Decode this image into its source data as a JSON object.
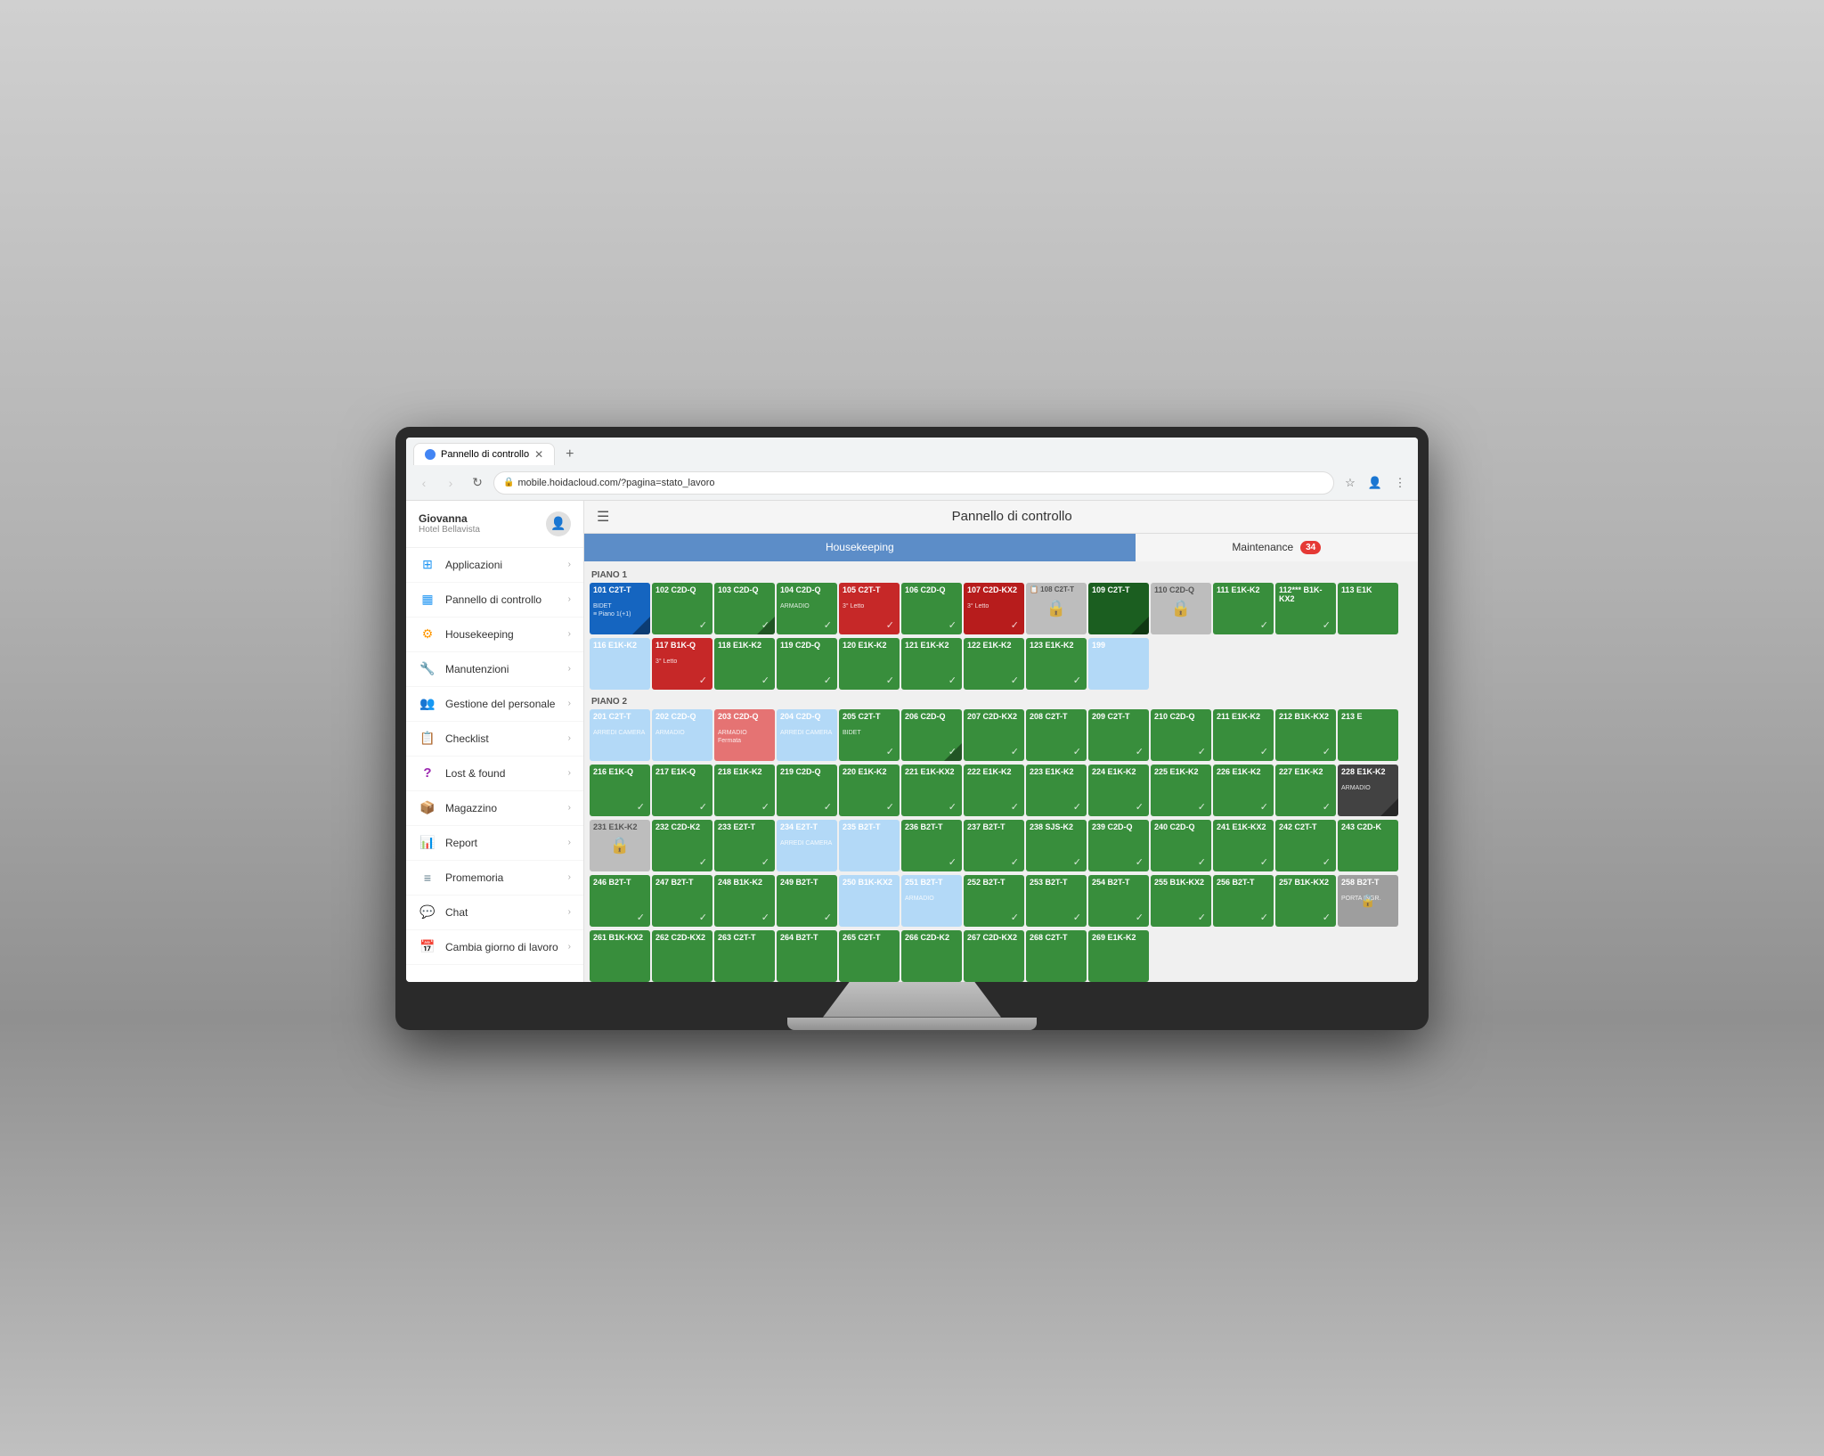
{
  "browser": {
    "tab_title": "Pannello di controllo",
    "url": "mobile.hoidacloud.com/?pagina=stato_lavoro",
    "new_tab_label": "+"
  },
  "header": {
    "menu_icon": "☰",
    "title": "Pannello di controllo"
  },
  "tabs": {
    "housekeeping": "Housekeeping",
    "maintenance": "Maintenance",
    "maintenance_badge": "34"
  },
  "sidebar": {
    "user_name": "Giovanna",
    "user_hotel": "Hotel Bellavista",
    "items": [
      {
        "id": "applicazioni",
        "label": "Applicazioni",
        "icon": "⊞",
        "icon_class": "icon-apps"
      },
      {
        "id": "pannello",
        "label": "Pannello di controllo",
        "icon": "▦",
        "icon_class": "icon-dashboard"
      },
      {
        "id": "housekeeping",
        "label": "Housekeeping",
        "icon": "⚙",
        "icon_class": "icon-housekeeping"
      },
      {
        "id": "manutenzioni",
        "label": "Manutenzioni",
        "icon": "🔧",
        "icon_class": "icon-maintenance"
      },
      {
        "id": "gestione",
        "label": "Gestione del personale",
        "icon": "👥",
        "icon_class": "icon-staff"
      },
      {
        "id": "checklist",
        "label": "Checklist",
        "icon": "📋",
        "icon_class": "icon-checklist"
      },
      {
        "id": "lost",
        "label": "Lost & found",
        "icon": "?",
        "icon_class": "icon-lost"
      },
      {
        "id": "magazzino",
        "label": "Magazzino",
        "icon": "📦",
        "icon_class": "icon-warehouse"
      },
      {
        "id": "report",
        "label": "Report",
        "icon": "📊",
        "icon_class": "icon-report"
      },
      {
        "id": "promemoria",
        "label": "Promemoria",
        "icon": "≡",
        "icon_class": "icon-promemoria"
      },
      {
        "id": "chat",
        "label": "Chat",
        "icon": "💬",
        "icon_class": "icon-chat"
      },
      {
        "id": "cambia",
        "label": "Cambia giorno di lavoro",
        "icon": "📅",
        "icon_class": "icon-calendar"
      }
    ]
  },
  "floor1": {
    "label": "PIANO 1",
    "rooms": [
      {
        "number": "101",
        "type": "C2T-T",
        "note": "BIDET\n≡ Piano 1(+1)",
        "color": "blue",
        "triangle": true
      },
      {
        "number": "102",
        "type": "C2D-Q",
        "note": "",
        "color": "mid-green",
        "check": true
      },
      {
        "number": "103",
        "type": "C2D-Q",
        "note": "",
        "color": "mid-green",
        "check": true,
        "triangle": true
      },
      {
        "number": "104",
        "type": "C2D-Q",
        "note": "ARMADIO",
        "color": "mid-green",
        "check": true
      },
      {
        "number": "105",
        "type": "C2T-T",
        "note": "3° Letto",
        "color": "red",
        "check": true
      },
      {
        "number": "106",
        "type": "C2D-Q",
        "note": "",
        "color": "mid-green",
        "check": true
      },
      {
        "number": "107",
        "type": "C2D-KX2",
        "note": "3° Letto",
        "color": "dark-red",
        "check": true
      },
      {
        "number": "108",
        "type": "C2T-T",
        "note": "",
        "color": "locked"
      },
      {
        "number": "109",
        "type": "C2T-T",
        "note": "",
        "color": "dark-green",
        "triangle": true
      },
      {
        "number": "110",
        "type": "C2D-Q",
        "note": "",
        "color": "locked"
      },
      {
        "number": "111",
        "type": "E1K-K2",
        "note": "",
        "color": "mid-green",
        "check": true
      },
      {
        "number": "112***",
        "type": "B1K-KX2",
        "note": "",
        "color": "mid-green",
        "check": true
      },
      {
        "number": "113",
        "type": "E1K",
        "note": "",
        "color": "mid-green"
      }
    ]
  },
  "floor1b": {
    "rooms": [
      {
        "number": "116",
        "type": "E1K-K2",
        "note": "",
        "color": "sky-blue"
      },
      {
        "number": "117",
        "type": "B1K-Q",
        "note": "3° Letto",
        "color": "red",
        "check": true
      },
      {
        "number": "118",
        "type": "E1K-K2",
        "note": "",
        "color": "mid-green",
        "check": true
      },
      {
        "number": "119",
        "type": "C2D-Q",
        "note": "",
        "color": "mid-green",
        "check": true
      },
      {
        "number": "120",
        "type": "E1K-K2",
        "note": "",
        "color": "mid-green",
        "check": true
      },
      {
        "number": "121",
        "type": "E1K-K2",
        "note": "",
        "color": "mid-green",
        "check": true
      },
      {
        "number": "122",
        "type": "E1K-K2",
        "note": "",
        "color": "mid-green",
        "check": true
      },
      {
        "number": "123",
        "type": "E1K-K2",
        "note": "",
        "color": "mid-green",
        "check": true
      },
      {
        "number": "199",
        "type": "",
        "note": "",
        "color": "sky-blue"
      }
    ]
  },
  "floor2": {
    "label": "PIANO 2",
    "rooms": [
      {
        "number": "201",
        "type": "C2T-T",
        "note": "ARREDI CAMERA",
        "color": "sky-blue"
      },
      {
        "number": "202",
        "type": "C2D-Q",
        "note": "ARMADIO",
        "color": "sky-blue"
      },
      {
        "number": "203",
        "type": "C2D-Q",
        "note": "ARMADIO\nFermata",
        "color": "salmon"
      },
      {
        "number": "204",
        "type": "C2D-Q",
        "note": "ARREDI CAMERA",
        "color": "sky-blue"
      },
      {
        "number": "205",
        "type": "C2T-T",
        "note": "BIDET",
        "color": "mid-green",
        "check": true
      },
      {
        "number": "206",
        "type": "C2D-Q",
        "note": "",
        "color": "mid-green",
        "check": true,
        "triangle": true
      },
      {
        "number": "207",
        "type": "C2D-KX2",
        "note": "",
        "color": "mid-green",
        "check": true
      },
      {
        "number": "208",
        "type": "C2T-T",
        "note": "",
        "color": "mid-green",
        "check": true
      },
      {
        "number": "209",
        "type": "C2T-T",
        "note": "",
        "color": "mid-green",
        "check": true
      },
      {
        "number": "210",
        "type": "C2D-Q",
        "note": "",
        "color": "mid-green",
        "check": true
      },
      {
        "number": "211",
        "type": "E1K-K2",
        "note": "",
        "color": "mid-green",
        "check": true
      },
      {
        "number": "212",
        "type": "B1K-KX2",
        "note": "",
        "color": "mid-green",
        "check": true
      },
      {
        "number": "213",
        "type": "E",
        "note": "",
        "color": "mid-green"
      }
    ]
  },
  "floor2b": {
    "rooms": [
      {
        "number": "216",
        "type": "E1K-Q",
        "note": "",
        "color": "mid-green",
        "check": true
      },
      {
        "number": "217",
        "type": "E1K-Q",
        "note": "",
        "color": "mid-green",
        "check": true
      },
      {
        "number": "218",
        "type": "E1K-K2",
        "note": "",
        "color": "mid-green",
        "check": true
      },
      {
        "number": "219",
        "type": "C2D-Q",
        "note": "",
        "color": "mid-green",
        "check": true
      },
      {
        "number": "220",
        "type": "E1K-K2",
        "note": "",
        "color": "mid-green",
        "check": true
      },
      {
        "number": "221",
        "type": "E1K-KX2",
        "note": "",
        "color": "mid-green",
        "check": true
      },
      {
        "number": "222",
        "type": "E1K-K2",
        "note": "",
        "color": "mid-green",
        "check": true
      },
      {
        "number": "223",
        "type": "E1K-K2",
        "note": "",
        "color": "mid-green",
        "check": true
      },
      {
        "number": "224",
        "type": "E1K-K2",
        "note": "",
        "color": "mid-green",
        "check": true
      },
      {
        "number": "225",
        "type": "E1K-K2",
        "note": "",
        "color": "mid-green",
        "check": true
      },
      {
        "number": "226",
        "type": "E1K-K2",
        "note": "",
        "color": "mid-green",
        "check": true
      },
      {
        "number": "227",
        "type": "E1K-K2",
        "note": "",
        "color": "mid-green",
        "check": true
      },
      {
        "number": "228",
        "type": "E1K-K2",
        "note": "ARMADIO",
        "color": "dark-gray",
        "triangle": true
      }
    ]
  },
  "floor2c": {
    "rooms": [
      {
        "number": "231",
        "type": "E1K-K2",
        "note": "",
        "color": "locked"
      },
      {
        "number": "232",
        "type": "C2D-K2",
        "note": "",
        "color": "mid-green",
        "check": true
      },
      {
        "number": "233",
        "type": "E2T-T",
        "note": "",
        "color": "mid-green",
        "check": true
      },
      {
        "number": "234",
        "type": "E2T-T",
        "note": "ARREDI CAMERA",
        "color": "sky-blue"
      },
      {
        "number": "235",
        "type": "B2T-T",
        "note": "",
        "color": "sky-blue"
      },
      {
        "number": "236",
        "type": "B2T-T",
        "note": "",
        "color": "mid-green",
        "check": true
      },
      {
        "number": "237",
        "type": "B2T-T",
        "note": "",
        "color": "mid-green",
        "check": true
      },
      {
        "number": "238",
        "type": "SJS-K2",
        "note": "",
        "color": "mid-green",
        "check": true
      },
      {
        "number": "239",
        "type": "C2D-Q",
        "note": "",
        "color": "mid-green",
        "check": true
      },
      {
        "number": "240",
        "type": "C2D-Q",
        "note": "",
        "color": "mid-green",
        "check": true
      },
      {
        "number": "241",
        "type": "E1K-KX2",
        "note": "",
        "color": "mid-green",
        "check": true
      },
      {
        "number": "242",
        "type": "C2T-T",
        "note": "",
        "color": "mid-green",
        "check": true
      },
      {
        "number": "243",
        "type": "C2D-K",
        "note": "",
        "color": "mid-green"
      }
    ]
  },
  "floor2d": {
    "rooms": [
      {
        "number": "246",
        "type": "B2T-T",
        "note": "",
        "color": "mid-green",
        "check": true
      },
      {
        "number": "247",
        "type": "B2T-T",
        "note": "",
        "color": "mid-green",
        "check": true
      },
      {
        "number": "248",
        "type": "B1K-K2",
        "note": "",
        "color": "mid-green",
        "check": true
      },
      {
        "number": "249",
        "type": "B2T-T",
        "note": "",
        "color": "mid-green",
        "check": true
      },
      {
        "number": "250",
        "type": "B1K-KX2",
        "note": "",
        "color": "sky-blue"
      },
      {
        "number": "251",
        "type": "B2T-T",
        "note": "ARMADIO",
        "color": "sky-blue"
      },
      {
        "number": "252",
        "type": "B2T-T",
        "note": "",
        "color": "mid-green",
        "check": true
      },
      {
        "number": "253",
        "type": "B2T-T",
        "note": "",
        "color": "mid-green",
        "check": true
      },
      {
        "number": "254",
        "type": "B2T-T",
        "note": "",
        "color": "mid-green",
        "check": true
      },
      {
        "number": "255",
        "type": "B1K-KX2",
        "note": "",
        "color": "mid-green",
        "check": true
      },
      {
        "number": "256",
        "type": "B2T-T",
        "note": "",
        "color": "mid-green",
        "check": true
      },
      {
        "number": "257",
        "type": "B1K-KX2",
        "note": "",
        "color": "mid-green",
        "check": true
      },
      {
        "number": "258",
        "type": "B2T-T",
        "note": "PORTA INGR.",
        "color": "gray",
        "lock": true
      }
    ]
  },
  "floor2e": {
    "rooms": [
      {
        "number": "261",
        "type": "B1K-KX2",
        "note": "",
        "color": "mid-green"
      },
      {
        "number": "262",
        "type": "C2D-KX2",
        "note": "",
        "color": "mid-green"
      },
      {
        "number": "263",
        "type": "C2T-T",
        "note": "",
        "color": "mid-green"
      },
      {
        "number": "264",
        "type": "B2T-T",
        "note": "",
        "color": "mid-green"
      },
      {
        "number": "265",
        "type": "C2T-T",
        "note": "",
        "color": "mid-green"
      },
      {
        "number": "266",
        "type": "C2D-K2",
        "note": "",
        "color": "mid-green"
      },
      {
        "number": "267",
        "type": "C2D-KX2",
        "note": "",
        "color": "mid-green"
      },
      {
        "number": "268",
        "type": "C2T-T",
        "note": "",
        "color": "mid-green"
      },
      {
        "number": "269",
        "type": "E1K-K2",
        "note": "",
        "color": "mid-green"
      }
    ]
  }
}
